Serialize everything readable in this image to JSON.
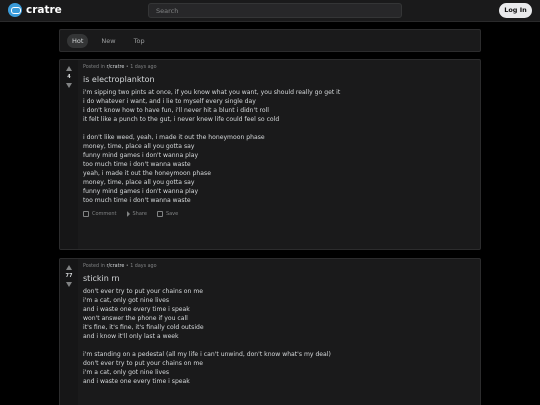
{
  "header": {
    "brand": "cratre",
    "search_placeholder": "Search",
    "login_label": "Log In"
  },
  "sort": {
    "tabs": [
      "Hot",
      "New",
      "Top"
    ],
    "active": "Hot"
  },
  "posts": [
    {
      "meta_prefix": "Posted in ",
      "subreddit": "r/cratre",
      "age": " • 1 days ago",
      "score": "4",
      "title": "is electroplankton",
      "lines": [
        "i'm sipping two pints at once, if you know what you want, you should really go get it",
        "i do whatever i want, and i lie to myself every single day",
        "i don't know how to have fun, i'll never hit a blunt i didn't roll",
        "it felt like a punch to the gut, i never knew life could feel so cold",
        "",
        "i don't like weed, yeah, i made it out the honeymoon phase",
        "money, time, place all you gotta say",
        "funny mind games i don't wanna play",
        "too much time i don't wanna waste",
        "yeah, i made it out the honeymoon phase",
        "money, time, place all you gotta say",
        "funny mind games i don't wanna play",
        "too much time i don't wanna waste"
      ],
      "actions": [
        "Comment",
        "Share",
        "Save"
      ]
    },
    {
      "meta_prefix": "Posted in ",
      "subreddit": "r/cratre",
      "age": " • 1 days ago",
      "score": "77",
      "title": "stickin rn",
      "lines": [
        "don't ever try to put your chains on me",
        "i'm a cat, only got nine lives",
        "and i waste one every time i speak",
        "won't answer the phone if you call",
        "it's fine, it's fine, it's finally cold outside",
        "and i know it'll only last a week",
        "",
        "i'm standing on a pedestal (all my life i can't unwind, don't know what's my deal)",
        "don't ever try to put your chains on me",
        "i'm a cat, only got nine lives",
        "and i waste one every time i speak"
      ]
    }
  ],
  "colors": {
    "background": "#000000",
    "panel": "#1a1a1b",
    "text": "#d7dadc",
    "muted": "#818384",
    "brand": "#3a9bd9"
  }
}
